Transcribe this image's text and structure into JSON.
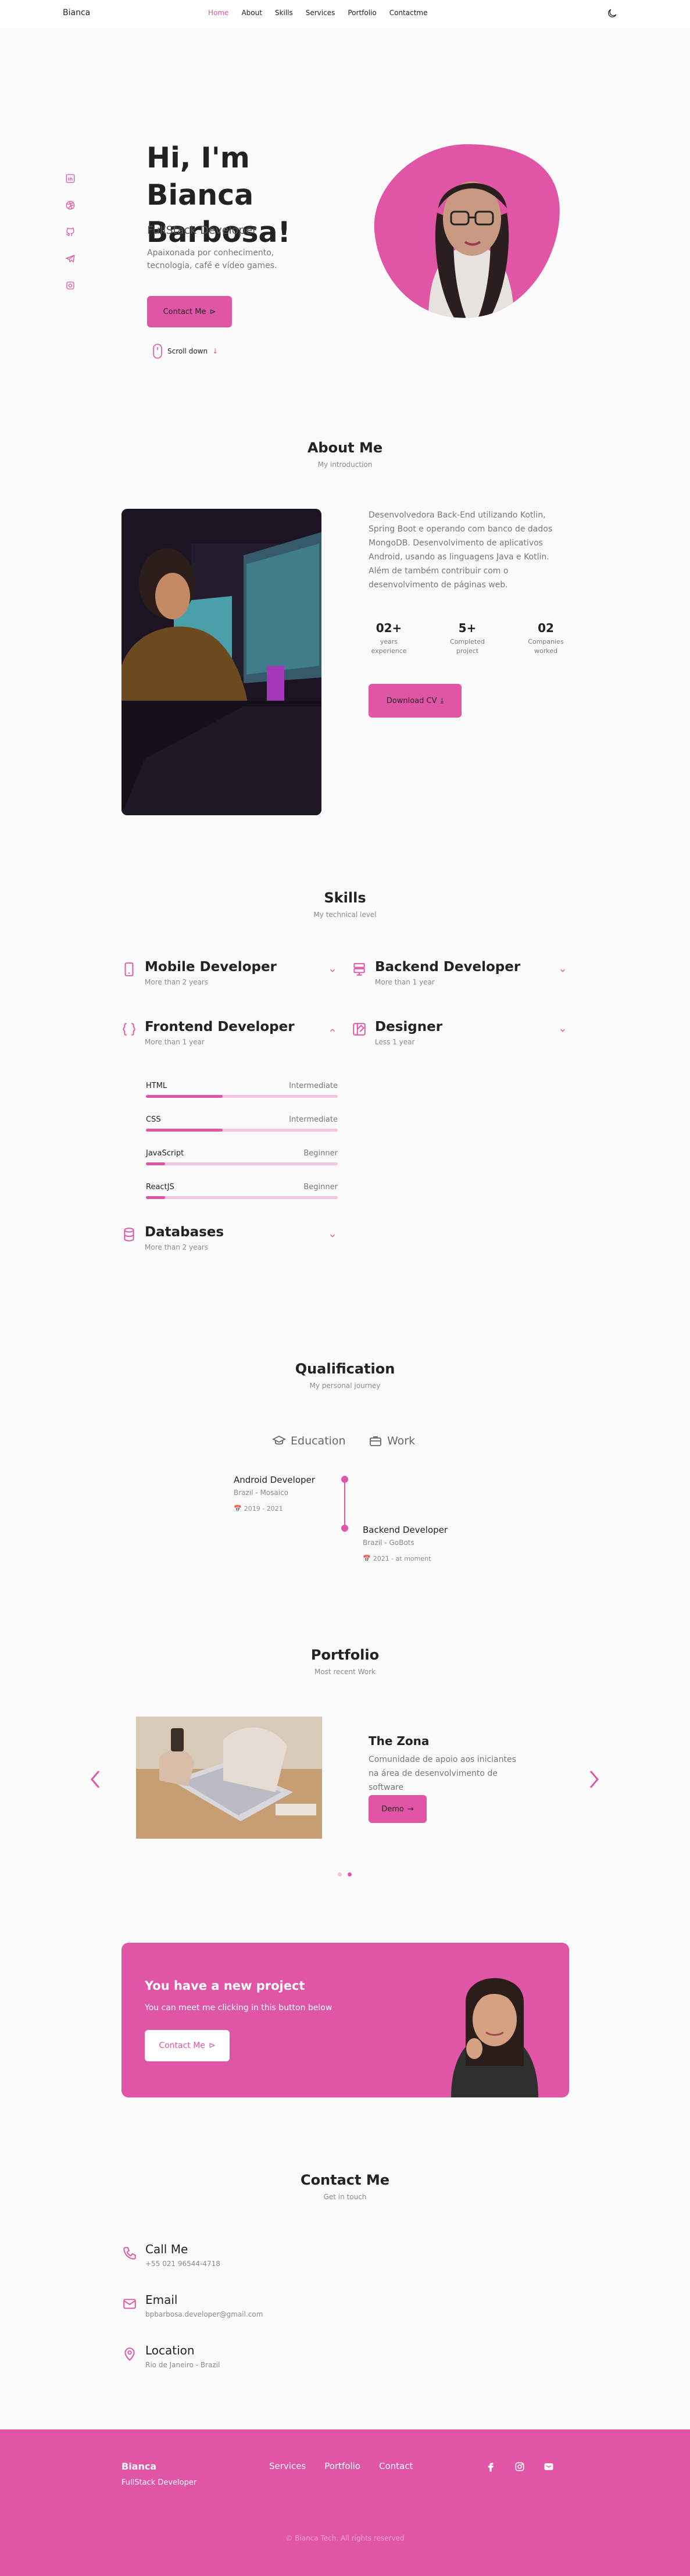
{
  "colors": {
    "accent": "#e055a6",
    "text": "#222222",
    "muted": "#8a8a8a"
  },
  "header": {
    "brand": "Bianca",
    "nav": [
      {
        "label": "Home",
        "active": true
      },
      {
        "label": "About"
      },
      {
        "label": "Skills"
      },
      {
        "label": "Services"
      },
      {
        "label": "Portfolio"
      },
      {
        "label": "Contactme"
      }
    ],
    "theme_icon": "moon-icon"
  },
  "hero": {
    "title": "Hi, I'm Bianca Barbosa!",
    "subtitle": "FullStack Developer",
    "description": "Apaixonada por conhecimento, tecnologia, café e vídeo games.",
    "contact_btn": "Contact Me",
    "scroll": "Scroll down",
    "social_icons": [
      "linkedin-icon",
      "dribbble-icon",
      "github-icon",
      "telegram-icon",
      "instagram-icon"
    ]
  },
  "about": {
    "title": "About Me",
    "subtitle": "My introduction",
    "description": "Desenvolvedora Back-End utilizando Kotlin, Spring Boot e operando com banco de dados MongoDB. Desenvolvimento de aplicativos Android, usando as linguagens Java e Kotlin. Além de também contribuir com o desenvolvimento de páginas web.",
    "stats": [
      {
        "number": "02+",
        "label_1": "years",
        "label_2": "experience"
      },
      {
        "number": "5+",
        "label_1": "Completed",
        "label_2": "project"
      },
      {
        "number": "02",
        "label_1": "Companies",
        "label_2": "worked"
      }
    ],
    "cv_btn": "Download CV"
  },
  "skills": {
    "title": "Skills",
    "subtitle": "My technical level",
    "groups": [
      {
        "title": "Mobile Developer",
        "sub": "More than 2 years",
        "icon": "smartphone-icon"
      },
      {
        "title": "Backend Developer",
        "sub": "More than 1 year",
        "icon": "server-icon"
      },
      {
        "title": "Frontend Developer",
        "sub": "More than 1 year",
        "icon": "brackets-icon",
        "expanded": true
      },
      {
        "title": "Designer",
        "sub": "Less 1 year",
        "icon": "palette-icon"
      },
      {
        "title": "Databases",
        "sub": "More than 2 years",
        "icon": "database-icon"
      }
    ],
    "frontend_items": [
      {
        "name": "HTML",
        "level": "Intermediate",
        "percent": 40
      },
      {
        "name": "CSS",
        "level": "Intermediate",
        "percent": 40
      },
      {
        "name": "JavaScript",
        "level": "Beginner",
        "percent": 10
      },
      {
        "name": "ReactJS",
        "level": "Beginner",
        "percent": 10
      }
    ]
  },
  "qualification": {
    "title": "Qualification",
    "subtitle": "My personal journey",
    "tabs": [
      {
        "label": "Education",
        "icon": "graduation-cap-icon"
      },
      {
        "label": "Work",
        "icon": "briefcase-icon"
      }
    ],
    "items": [
      {
        "title": "Android Developer",
        "place": "Brazil - Mosaico",
        "date": "2019 - 2021"
      },
      {
        "title": "Backend Developer",
        "place": "Brazil - GoBots",
        "date": "2021 - at moment"
      }
    ]
  },
  "portfolio": {
    "title": "Portfolio",
    "subtitle": "Most recent Work",
    "project_title": "The Zona",
    "project_desc": "Comunidade de apoio aos iniciantes na área de desenvolvimento de software",
    "demo_btn": "Demo",
    "active_slide": 2,
    "slides": 2
  },
  "banner": {
    "title": "You have a new project",
    "text": "You can meet me clicking in this button below",
    "btn": "Contact Me"
  },
  "contact": {
    "title": "Contact Me",
    "subtitle": "Get in touch",
    "items": [
      {
        "title": "Call Me",
        "value": "+55 021 96544-4718",
        "icon": "phone-icon"
      },
      {
        "title": "Email",
        "value": "bpbarbosa.developer@gmail.com",
        "icon": "mail-icon"
      },
      {
        "title": "Location",
        "value": "Rio de Janeiro - Brazil",
        "icon": "map-pin-icon"
      }
    ]
  },
  "footer": {
    "name": "Bianca",
    "role": "FullStack Developer",
    "links": [
      "Services",
      "Portfolio",
      "Contact"
    ],
    "social_icons": [
      "facebook-icon",
      "instagram-icon",
      "twitter-icon"
    ],
    "copyright": "© Bianca Tech. All rights reserved"
  }
}
